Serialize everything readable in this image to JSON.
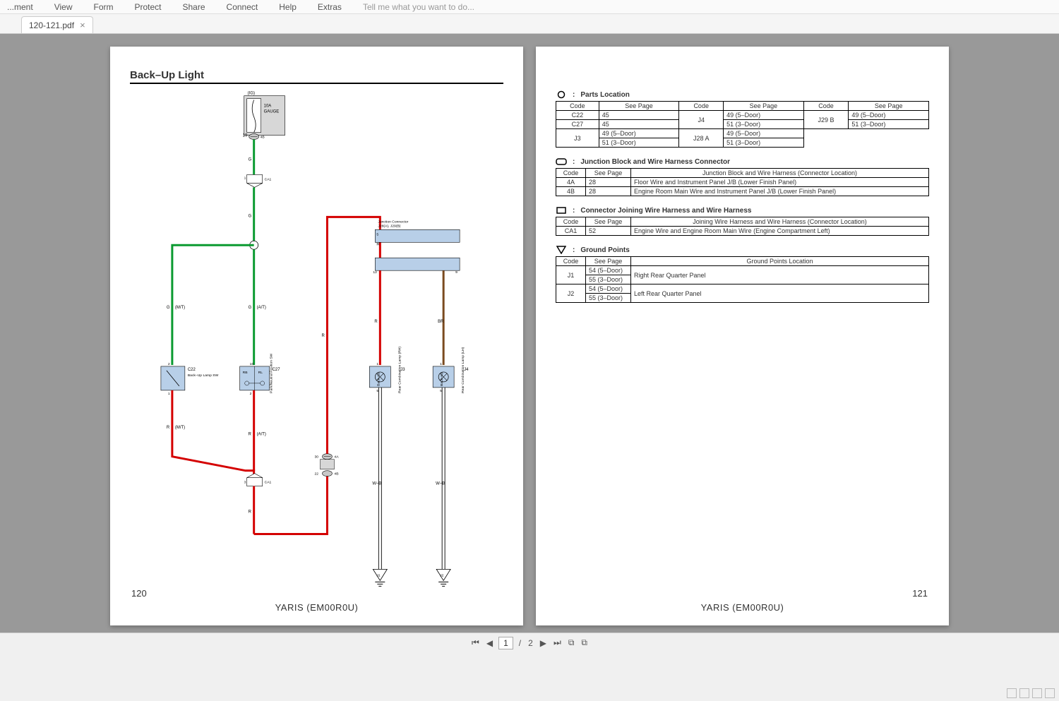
{
  "menu": {
    "items": [
      "...ment",
      "View",
      "Form",
      "Protect",
      "Share",
      "Connect",
      "Help",
      "Extras"
    ],
    "hint": "Tell me what you want to do..."
  },
  "tab": {
    "name": "120-121.pdf"
  },
  "page1": {
    "title": "Back–Up Light",
    "pageNum": "120",
    "footer": "YARIS (EM00R0U)",
    "diagram": {
      "fuse": {
        "id": "(IG)",
        "label": "10A\nGAUGE",
        "pin": "19"
      },
      "conn_top": {
        "label": "CA1",
        "pin1": "1",
        "pin2": "2"
      },
      "conn_bot": {
        "label": "CA1",
        "pin": "3"
      },
      "conn_4A": {
        "pin": "30",
        "label": "4A"
      },
      "conn_4B": {
        "pin": "22",
        "label": "4B"
      },
      "box_c22": {
        "code": "C22",
        "label": "Back–Up Lamp SW",
        "pin_t": "2",
        "pin_b": "1"
      },
      "box_c27": {
        "code": "C27",
        "label": "Park/Neutral Position SW",
        "cell1": "RB",
        "cell2": "RL",
        "pin_t": "10",
        "pin_b": "2"
      },
      "jc": {
        "label": "J28(A), J29(B)\nJunction Connector",
        "pin_l": "12",
        "pin_rtop": "5",
        "pin_rbot": "9"
      },
      "lamp_j3": {
        "code": "J3",
        "label": "Rear Combination Lamp (RH)",
        "sub": "Back–Up",
        "pin_t": "1",
        "pin_b": "5"
      },
      "lamp_j4": {
        "code": "J4",
        "label": "Rear Combination Lamp (LH)",
        "sub": "Back–Up",
        "pin_t": "1",
        "pin_b": "5"
      },
      "gnd_j1": "J1",
      "gnd_j2": "J2",
      "wires": {
        "g": "G",
        "r": "R",
        "br": "BR",
        "wb": "W–B",
        "mt": "(M/T)",
        "at": "(A/T)"
      }
    }
  },
  "page2": {
    "pageNum": "121",
    "footer": "YARIS (EM00R0U)",
    "parts": {
      "title": "Parts Location",
      "head": [
        "Code",
        "See Page",
        "Code",
        "See Page",
        "Code",
        "See Page"
      ],
      "rows": [
        [
          "C22",
          "45",
          "J4",
          "49 (5–Door)",
          "J29  B",
          "49 (5–Door)"
        ],
        [
          "C27",
          "45",
          "",
          "51 (3–Door)",
          "",
          "51 (3–Door)"
        ],
        [
          "J3",
          "49 (5–Door)",
          "J28  A",
          "49 (5–Door)",
          "",
          ""
        ],
        [
          "",
          "51 (3–Door)",
          "",
          "51 (3–Door)",
          "",
          ""
        ]
      ]
    },
    "jb": {
      "title": "Junction Block and Wire Harness Connector",
      "head": [
        "Code",
        "See Page",
        "Junction Block and Wire Harness (Connector Location)"
      ],
      "rows": [
        [
          "4A",
          "28",
          "Floor Wire and Instrument Panel J/B (Lower Finish Panel)"
        ],
        [
          "4B",
          "28",
          "Engine Room Main Wire and Instrument Panel J/B (Lower Finish Panel)"
        ]
      ]
    },
    "cj": {
      "title": "Connector Joining Wire Harness and Wire Harness",
      "head": [
        "Code",
        "See Page",
        "Joining Wire Harness and Wire Harness (Connector Location)"
      ],
      "rows": [
        [
          "CA1",
          "52",
          "Engine Wire and Engine Room Main Wire (Engine Compartment Left)"
        ]
      ]
    },
    "gp": {
      "title": "Ground Points",
      "head": [
        "Code",
        "See Page",
        "Ground Points Location"
      ],
      "rows": [
        [
          "J1",
          "54 (5–Door)",
          "Right Rear Quarter Panel"
        ],
        [
          "",
          "55 (3–Door)",
          ""
        ],
        [
          "J2",
          "54 (5–Door)",
          "Left Rear Quarter Panel"
        ],
        [
          "",
          "55 (3–Door)",
          ""
        ]
      ]
    }
  },
  "nav": {
    "page": "1",
    "total": "2"
  }
}
